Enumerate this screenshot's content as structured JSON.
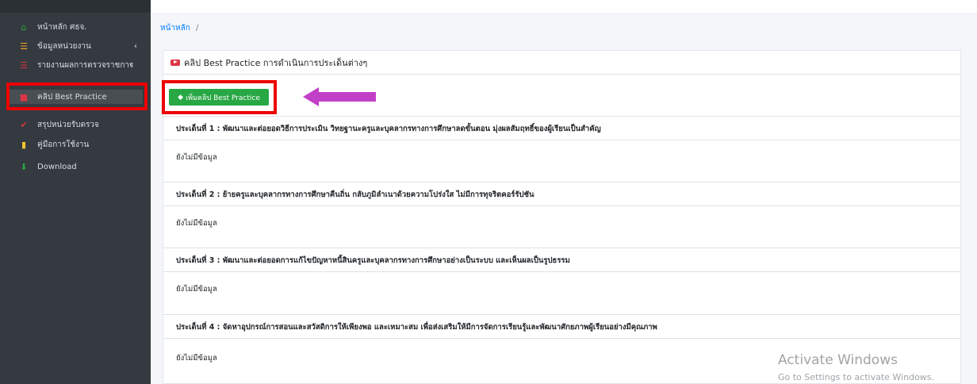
{
  "sidebar": {
    "items": [
      {
        "icon": "home-icon",
        "label": "หน้าหลัก ศธจ.",
        "glyph": "🏠"
      },
      {
        "icon": "list-icon",
        "label": "ข้อมูลหน่วยงาน",
        "glyph": "☰",
        "chevron": "‹"
      },
      {
        "icon": "list-icon",
        "label": "รายงานผลการตรวจราชการ",
        "glyph": "☰",
        "chevron": "‹"
      },
      {
        "icon": "video-icon",
        "label": "คลิป Best Practice",
        "glyph": "■"
      },
      {
        "icon": "check-icon",
        "label": "สรุปหน่วยรับตรวจ",
        "glyph": "✔"
      },
      {
        "icon": "book-icon",
        "label": "คู่มือการใช้งาน",
        "glyph": "▮"
      },
      {
        "icon": "download-icon",
        "label": "Download",
        "glyph": "⬇"
      }
    ],
    "active_index": 3
  },
  "breadcrumb": {
    "home": "หน้าหลัก",
    "separator": "/"
  },
  "card": {
    "title": "คลิป Best Practice การดำเนินการประเด็นต่างๆ",
    "add_button": "เพิ่มคลิป Best Practice",
    "issues": [
      {
        "title": "ประเด็นที่ 1 : พัฒนาและต่อยอดวิธีการประเมิน วิทยฐานะครูและบุคลากรทางการศึกษาลดขั้นตอน มุ่งผลสัมฤทธิ์ของผู้เรียนเป็นสำคัญ",
        "content": "ยังไม่มีข้อมูล"
      },
      {
        "title": "ประเด็นที่ 2 : ย้ายครูและบุคลากรทางการศึกษาคืนถิ่น กลับภูมิลำเนาด้วยความโปร่งใส ไม่มีการทุจริตคอร์รัปชัน",
        "content": "ยังไม่มีข้อมูล"
      },
      {
        "title": "ประเด็นที่ 3 : พัฒนาและต่อยอดการแก้ไขปัญหาหนี้สินครูและบุคลากรทางการศึกษาอย่างเป็นระบบ และเห็นผลเป็นรูปธรรม",
        "content": "ยังไม่มีข้อมูล"
      },
      {
        "title": "ประเด็นที่ 4 : จัดหาอุปกรณ์การสอนและสวัสดิการให้เพียงพอ และเหมาะสม เพื่อส่งเสริมให้มีการจัดการเรียนรู้และพัฒนาศักยภาพผู้เรียนอย่างมีคุณภาพ",
        "content": "ยังไม่มีข้อมูล"
      }
    ]
  },
  "watermark": {
    "title": "Activate Windows",
    "subtitle": "Go to Settings to activate Windows."
  },
  "colors": {
    "sidebar": "#343a40",
    "accent": "#28a745",
    "highlight": "#ee0000",
    "arrow": "#c23fc8",
    "link": "#007bff"
  }
}
